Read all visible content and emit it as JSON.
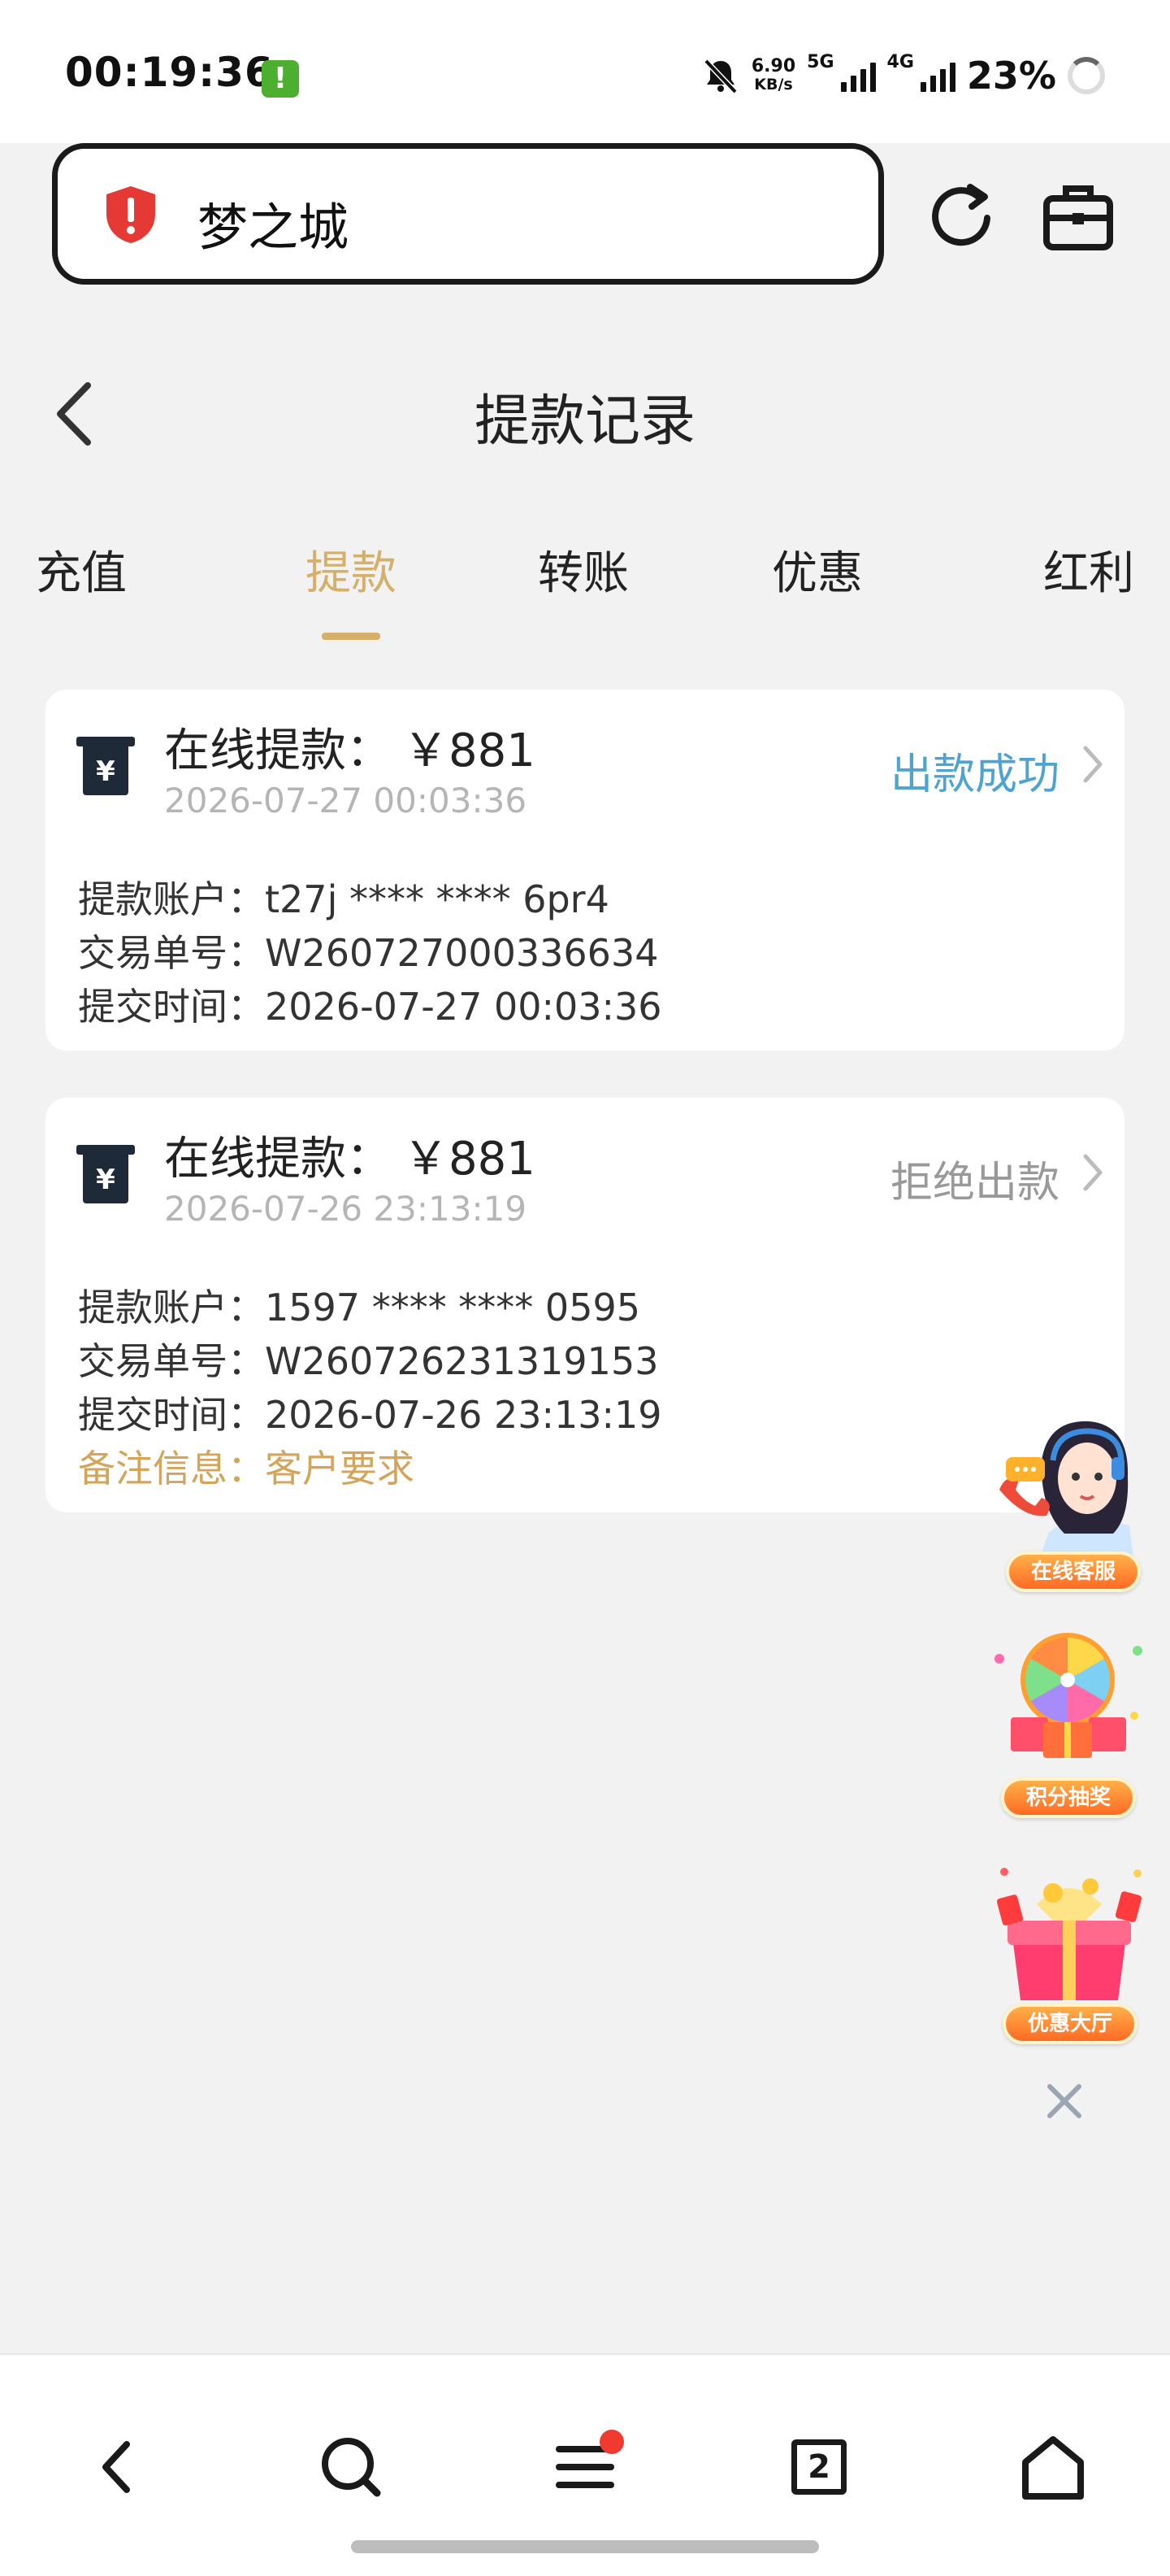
{
  "status_bar": {
    "time": "00:19:36",
    "notification_badge": "!",
    "net_speed_value": "6.90",
    "net_speed_unit": "KB/s",
    "net_5g": "5G",
    "net_4g": "4G",
    "battery": "23%"
  },
  "browser": {
    "url_title": "梦之城",
    "accent_color": "#e53935"
  },
  "page": {
    "title": "提款记录"
  },
  "tabs": [
    {
      "label": "充值",
      "active": false
    },
    {
      "label": "提款",
      "active": true
    },
    {
      "label": "转账",
      "active": false
    },
    {
      "label": "优惠",
      "active": false
    },
    {
      "label": "红利",
      "active": false
    }
  ],
  "records": [
    {
      "title": "在线提款：",
      "amount": "￥881",
      "time": "2026-07-27 00:03:36",
      "status": "出款成功",
      "status_color": "#4fa3d1",
      "account_label": "提款账户：",
      "account_value": "t27j **** **** 6pr4",
      "order_label": "交易单号：",
      "order_value": "W260727000336634",
      "submit_label": "提交时间：",
      "submit_value": "2026-07-27 00:03:36"
    },
    {
      "title": "在线提款：",
      "amount": "￥881",
      "time": "2026-07-26 23:13:19",
      "status": "拒绝出款",
      "status_color": "#999999",
      "account_label": "提款账户：",
      "account_value": "1597 **** **** 0595",
      "order_label": "交易单号：",
      "order_value": "W260726231319153",
      "submit_label": "提交时间：",
      "submit_value": "2026-07-26 23:13:19",
      "note_label": "备注信息：",
      "note_value": "客户要求"
    }
  ],
  "floating": [
    {
      "label": "在线客服",
      "icon": "customer-service-icon"
    },
    {
      "label": "积分抽奖",
      "icon": "lucky-wheel-icon"
    },
    {
      "label": "优惠大厅",
      "icon": "gift-box-icon"
    }
  ],
  "bottom_nav": {
    "tab_count": "2",
    "items": [
      "back-icon",
      "search-icon",
      "menu-icon",
      "tabs-icon",
      "home-icon"
    ]
  },
  "colors": {
    "accent_gold": "#d4b06a",
    "success_blue": "#4fa3d1",
    "note_gold": "#d4a45a"
  }
}
